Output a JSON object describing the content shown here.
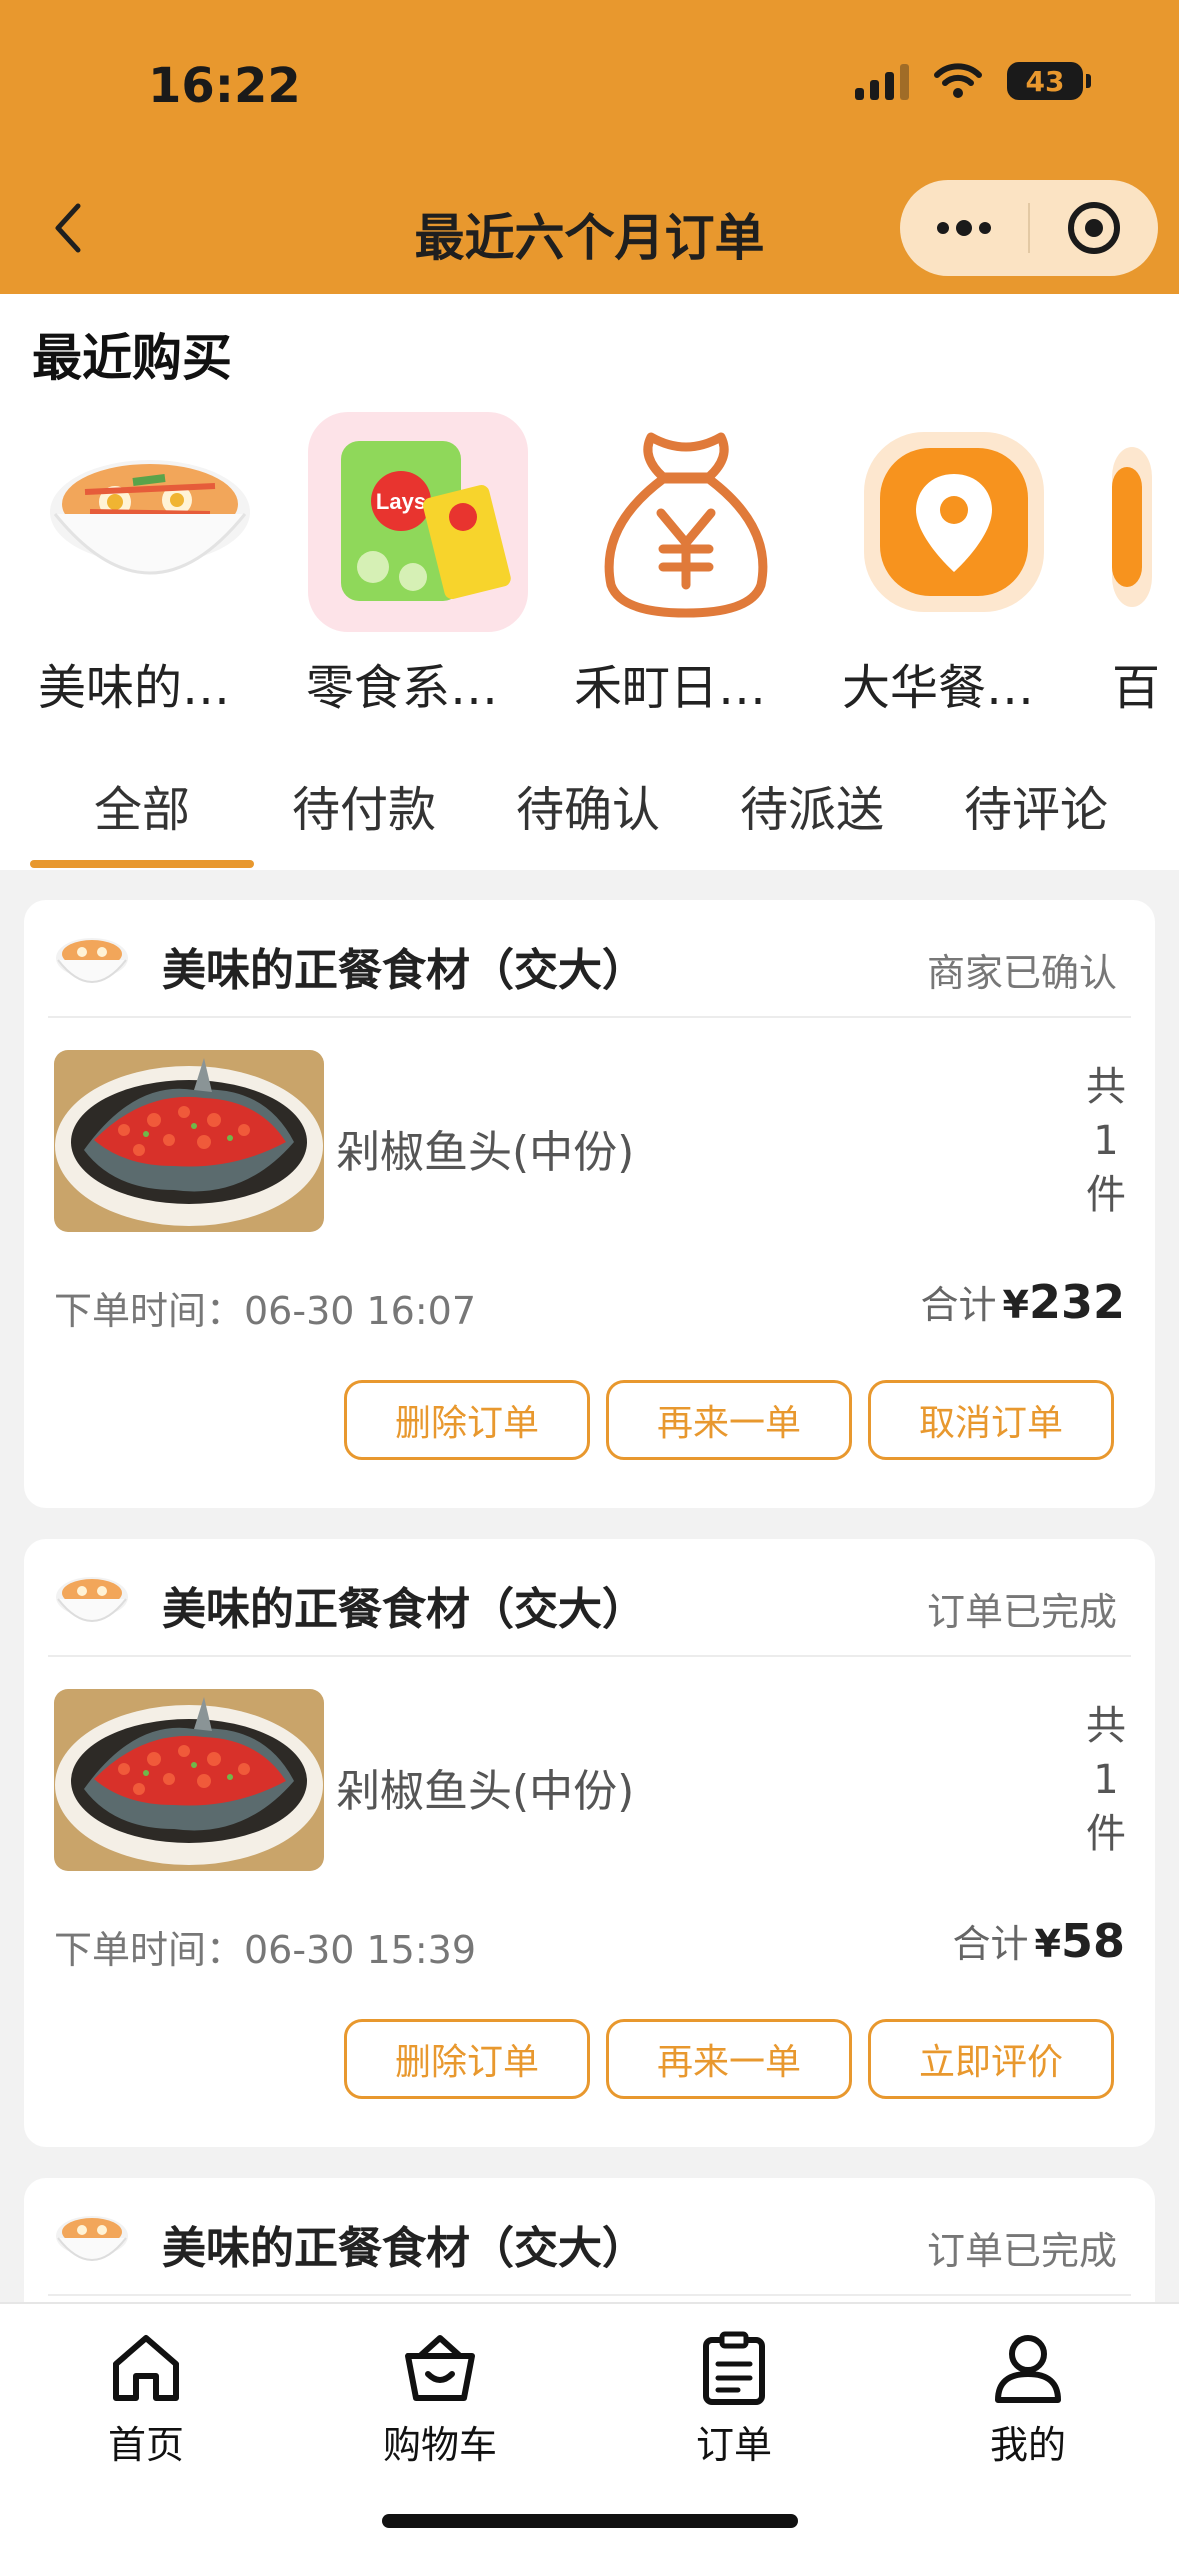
{
  "status_bar": {
    "time": "16:22",
    "battery": "43"
  },
  "nav": {
    "title": "最近六个月订单"
  },
  "recent": {
    "title": "最近购买",
    "items": [
      {
        "label": "美味的…",
        "icon": "noodle-bowl"
      },
      {
        "label": "零食系…",
        "icon": "chips-bag"
      },
      {
        "label": "禾町日…",
        "icon": "money-bag-yen"
      },
      {
        "label": "大华餐…",
        "icon": "location-pin"
      },
      {
        "label": "百",
        "icon": "partial"
      }
    ]
  },
  "tabs": [
    "全部",
    "待付款",
    "待确认",
    "待派送",
    "待评论"
  ],
  "orders": [
    {
      "shop": "美味的正餐食材（交大）",
      "status": "商家已确认",
      "goods_name": "剁椒鱼头(中份)",
      "count_top": "共",
      "count_num": "1",
      "count_unit": "件",
      "time": "下单时间：06-30 16:07",
      "total_label": "合计",
      "currency": "¥",
      "amount": "232",
      "buttons": [
        "删除订单",
        "再来一单",
        "取消订单"
      ]
    },
    {
      "shop": "美味的正餐食材（交大）",
      "status": "订单已完成",
      "goods_name": "剁椒鱼头(中份)",
      "count_top": "共",
      "count_num": "1",
      "count_unit": "件",
      "time": "下单时间：06-30 15:39",
      "total_label": "合计",
      "currency": "¥",
      "amount": "58",
      "buttons": [
        "删除订单",
        "再来一单",
        "立即评价"
      ]
    },
    {
      "shop": "美味的正餐食材（交大）",
      "status": "订单已完成"
    }
  ],
  "tabbar": [
    {
      "label": "首页",
      "icon": "home-icon"
    },
    {
      "label": "购物车",
      "icon": "basket-icon"
    },
    {
      "label": "订单",
      "icon": "clipboard-icon"
    },
    {
      "label": "我的",
      "icon": "user-icon"
    }
  ],
  "colors": {
    "accent": "#e8982e"
  }
}
